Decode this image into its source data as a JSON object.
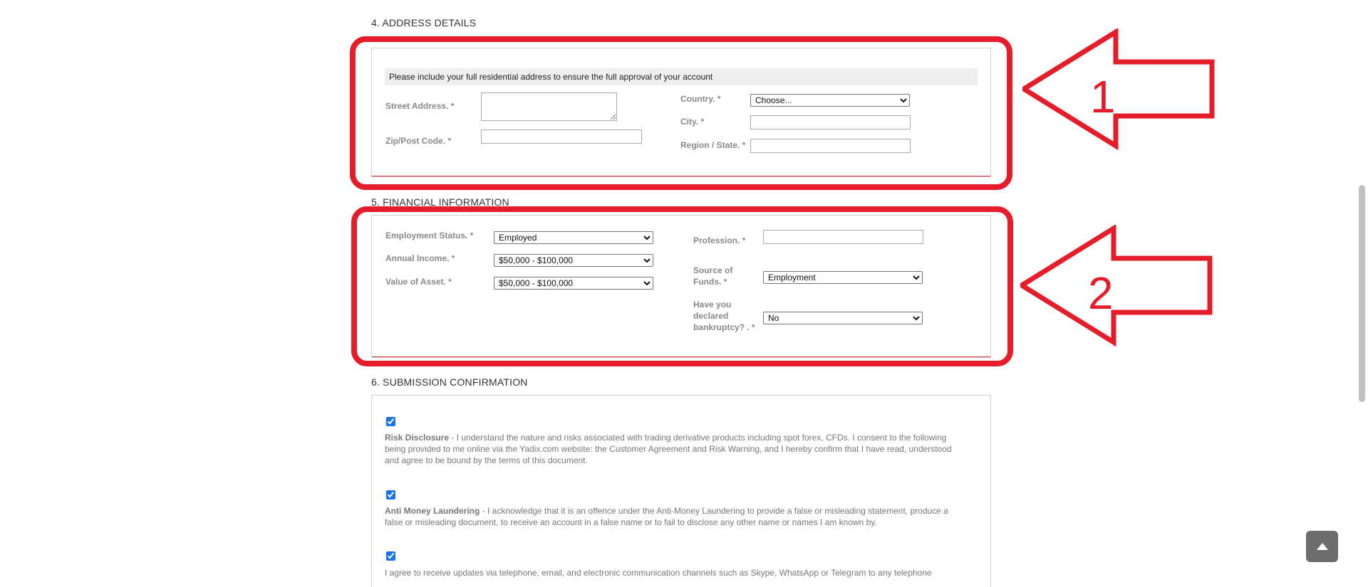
{
  "address": {
    "title": "4. ADDRESS DETAILS",
    "notice": "Please include your full residential address to ensure the full approval of your account",
    "street_label": "Street Address. *",
    "street_value": "",
    "zip_label": "Zip/Post Code. *",
    "zip_value": "",
    "country_label": "Country. *",
    "country_selected": "Choose...",
    "city_label": "City. *",
    "city_value": "",
    "region_label": "Region / State. *",
    "region_value": ""
  },
  "financial": {
    "title": "5. FINANCIAL INFORMATION",
    "employment_label": "Employment Status. *",
    "employment_selected": "Employed",
    "income_label": "Annual Income. *",
    "income_selected": "$50,000 - $100,000",
    "asset_label": "Value of Asset. *",
    "asset_selected": "$50,000 - $100,000",
    "profession_label": "Profession. *",
    "profession_value": "",
    "source_label_line1": "Source of",
    "source_label_line2": "Funds. *",
    "source_selected": "Employment",
    "bankruptcy_label_line1": "Have you",
    "bankruptcy_label_line2": "declared",
    "bankruptcy_label_line3": "bankruptcy? . *",
    "bankruptcy_selected": "No"
  },
  "submission": {
    "title": "6. SUBMISSION CONFIRMATION",
    "risk_title": "Risk Disclosure",
    "risk_text": " -  I understand the nature and risks associated with trading derivative products including spot forex, CFDs. I consent to the following being provided to me online via the Yadix.com website: the Customer Agreement and Risk Warning, and I hereby confirm that I have read, understood and agree to be bound by the terms of this document.",
    "aml_title": "Anti Money Laundering",
    "aml_text": " - I acknowledge that it is an offence under the Anti-Money Laundering to provide a false or misleading statement, produce a false or misleading document, to receive an account in a false name or to fail to disclose any other name or names I am known by.",
    "updates_text": "I agree to receive updates via telephone, email, and electronic communication channels such as Skype, WhatsApp or Telegram to any telephone"
  },
  "annotations": {
    "arrow1_number": "1",
    "arrow2_number": "2",
    "color": "#e51d2a"
  },
  "icons": {
    "scroll_top": "caret-up-icon"
  }
}
